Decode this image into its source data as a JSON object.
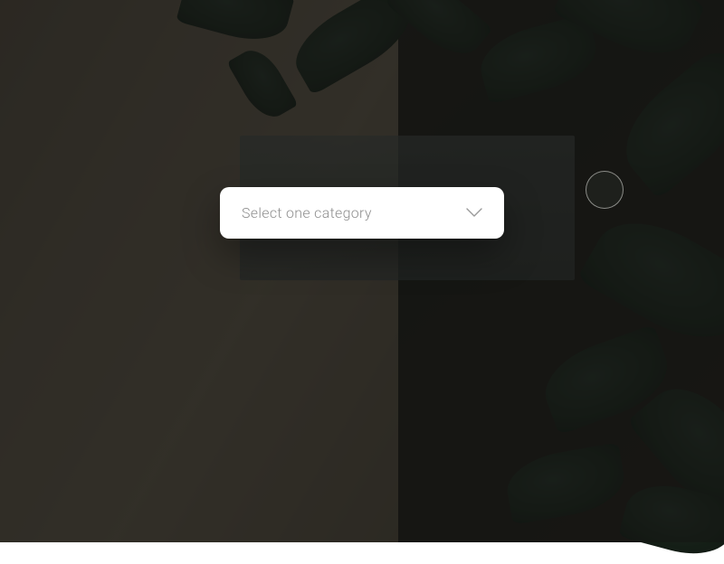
{
  "dropdown": {
    "placeholder": "Select one category"
  }
}
